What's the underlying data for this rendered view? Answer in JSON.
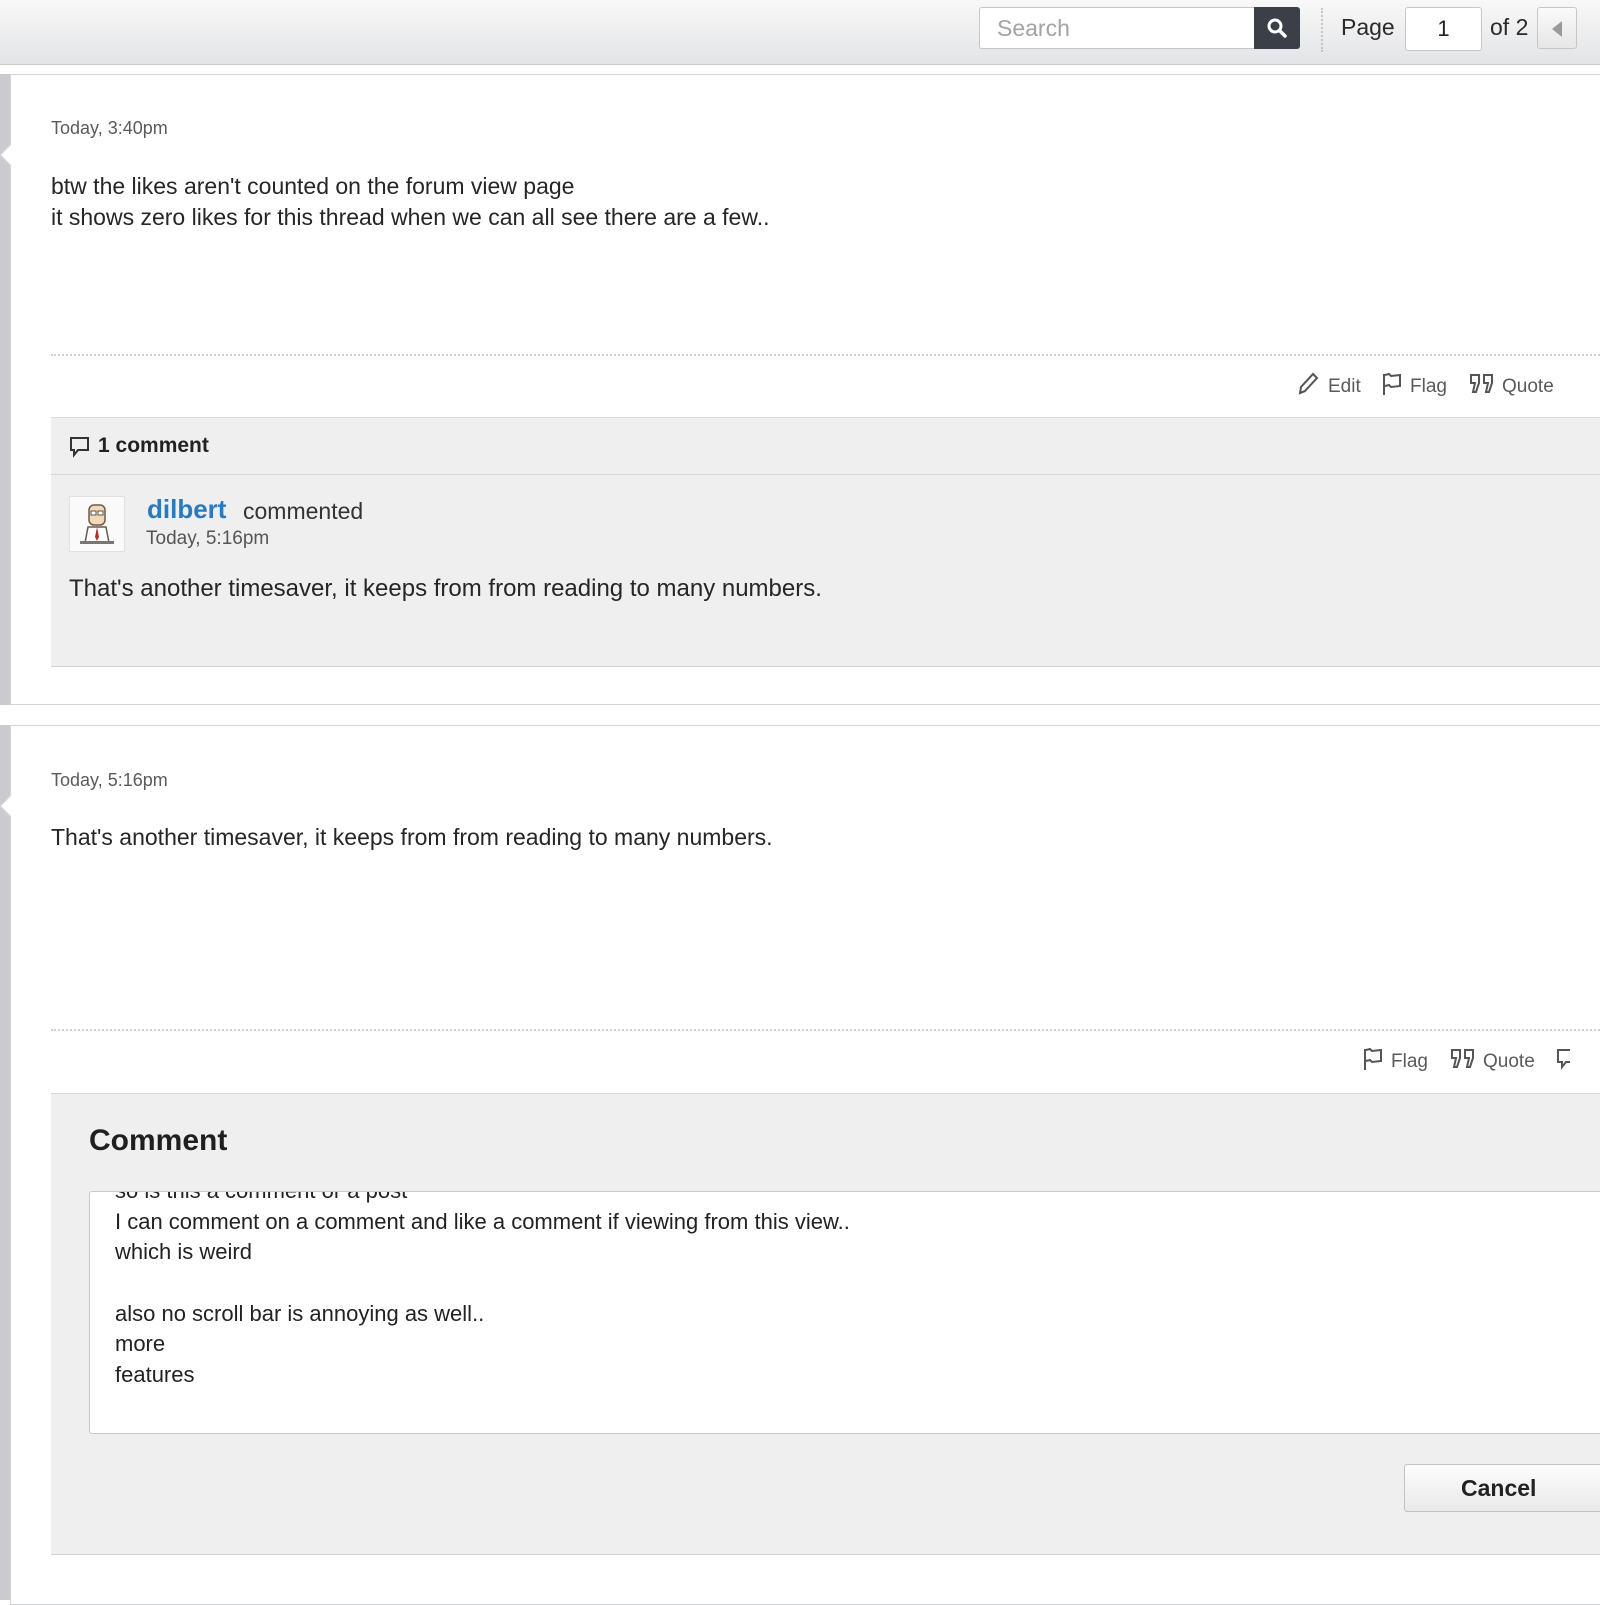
{
  "toolbar": {
    "search_placeholder": "Search",
    "page_label": "Page",
    "current_page": "1",
    "page_total": "of 2"
  },
  "posts": [
    {
      "time": "Today, 3:40pm",
      "body": [
        "btw the likes aren't counted on the forum view page",
        "it shows zero likes for this thread when we can all see there are a few.."
      ],
      "actions": {
        "edit": "Edit",
        "flag": "Flag",
        "quote": "Quote"
      },
      "comments": {
        "count_label": "1 comment",
        "items": [
          {
            "author": "dilbert",
            "verb": "commented",
            "time": "Today, 5:16pm",
            "text": "That's another timesaver, it keeps from from reading to many numbers."
          }
        ]
      }
    },
    {
      "time": "Today, 5:16pm",
      "body": [
        "That's another timesaver, it keeps from from reading to many numbers."
      ],
      "actions": {
        "flag": "Flag",
        "quote": "Quote"
      },
      "composer": {
        "title": "Comment",
        "lines": [
          "so is this a comment or a post",
          "I can comment on a comment and like a comment if viewing from this view..",
          "which is weird",
          "",
          "also no scroll bar is annoying as well..",
          "more",
          "features"
        ],
        "cancel_label": "Cancel"
      }
    }
  ]
}
